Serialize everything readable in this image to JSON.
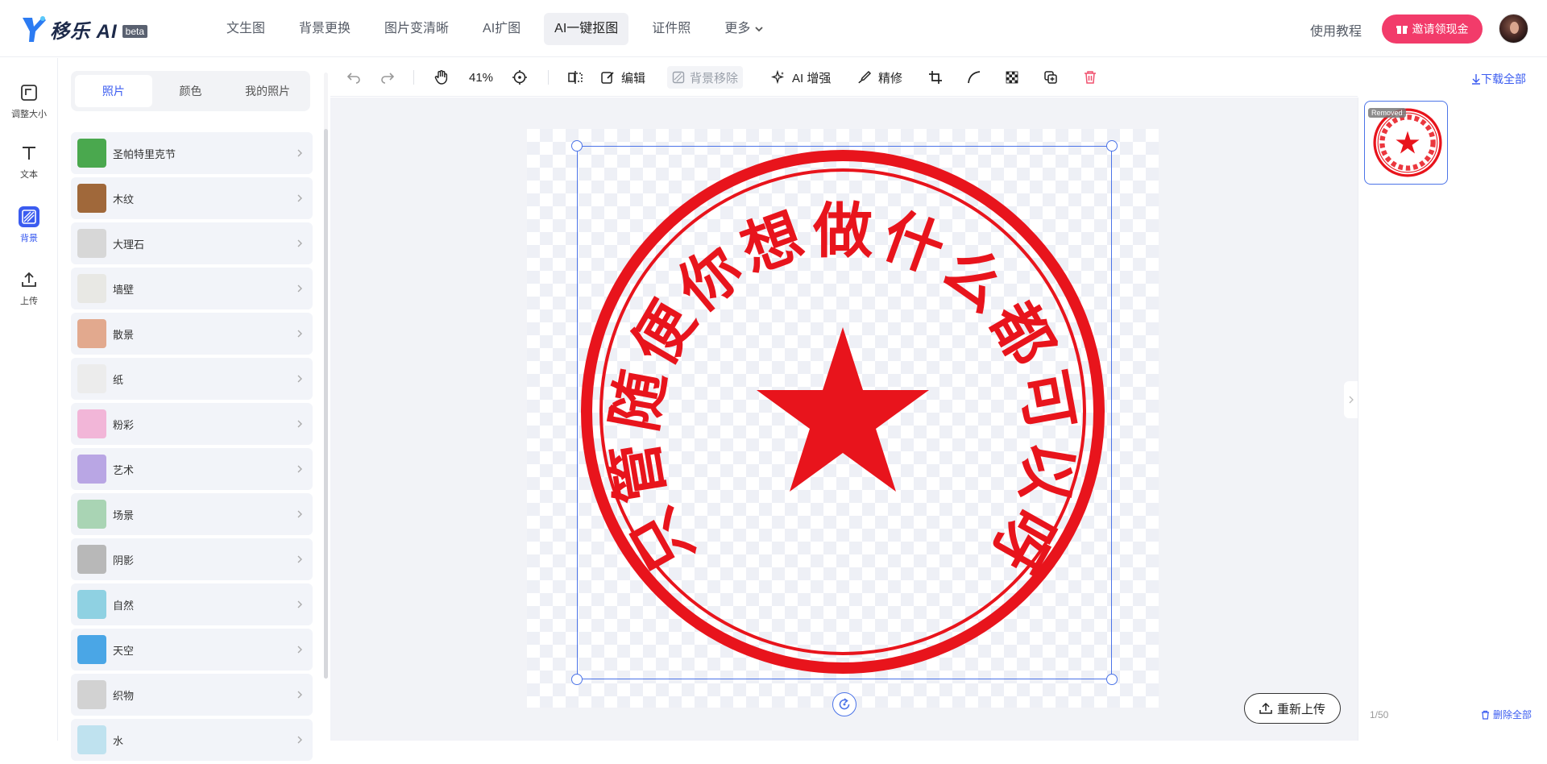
{
  "app": {
    "logo_text": "移乐 AI",
    "beta": "beta"
  },
  "nav": {
    "items": [
      "文生图",
      "背景更换",
      "图片变清晰",
      "AI扩图",
      "AI一键抠图",
      "证件照"
    ],
    "more": "更多",
    "active_index": 4
  },
  "header": {
    "tutorial": "使用教程",
    "invite": "邀请领现金"
  },
  "leftbar": {
    "items": [
      {
        "label": "调整大小",
        "icon": "resize-icon"
      },
      {
        "label": "文本",
        "icon": "text-icon"
      },
      {
        "label": "背景",
        "icon": "background-icon"
      },
      {
        "label": "上传",
        "icon": "upload-icon"
      }
    ],
    "active_index": 2
  },
  "panel": {
    "tabs": [
      "照片",
      "颜色",
      "我的照片"
    ],
    "active_tab": 0,
    "categories": [
      {
        "label": "圣帕特里克节",
        "thumb": "#4aa84e"
      },
      {
        "label": "木纹",
        "thumb": "#a0683a"
      },
      {
        "label": "大理石",
        "thumb": "#d7d7d7"
      },
      {
        "label": "墙壁",
        "thumb": "#e8e8e4"
      },
      {
        "label": "散景",
        "thumb": "#e2a98e"
      },
      {
        "label": "纸",
        "thumb": "#ececec"
      },
      {
        "label": "粉彩",
        "thumb": "#f2b6d8"
      },
      {
        "label": "艺术",
        "thumb": "#b9a6e4"
      },
      {
        "label": "场景",
        "thumb": "#a9d4b4"
      },
      {
        "label": "阴影",
        "thumb": "#b8b8b8"
      },
      {
        "label": "自然",
        "thumb": "#8fd1e2"
      },
      {
        "label": "天空",
        "thumb": "#4aa6e6"
      },
      {
        "label": "织物",
        "thumb": "#d2d2d2"
      },
      {
        "label": "水",
        "thumb": "#bfe2ef"
      }
    ]
  },
  "toolbar": {
    "zoom": "41%",
    "edit": "编辑",
    "bg_remove": "背景移除",
    "ai_enhance": "AI 增强",
    "refine": "精修",
    "download_all": "下载全部"
  },
  "seal": {
    "color": "#e8141c",
    "outer_text": "只管随便你想做什么都可以呀"
  },
  "canvas": {
    "reupload": "重新上传"
  },
  "rightpanel": {
    "badge": "Removed",
    "count": "1/50",
    "delete_all": "删除全部"
  },
  "colors": {
    "accent": "#3b5cf0",
    "invite": "#f23b6a",
    "seal_red": "#e8141c"
  }
}
